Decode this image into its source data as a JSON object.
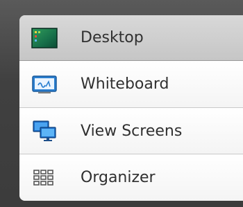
{
  "menu": {
    "items": [
      {
        "label": "Desktop",
        "icon": "desktop-icon",
        "selected": true
      },
      {
        "label": "Whiteboard",
        "icon": "whiteboard-icon",
        "selected": false
      },
      {
        "label": "View Screens",
        "icon": "view-screens-icon",
        "selected": false
      },
      {
        "label": "Organizer",
        "icon": "organizer-grid-icon",
        "selected": false
      }
    ]
  },
  "colors": {
    "background": "#4a4a4a",
    "selected_item": "#cfcfcf",
    "item": "#f8f8f8",
    "text": "#303030",
    "icon_blue": "#1e6fc8"
  }
}
